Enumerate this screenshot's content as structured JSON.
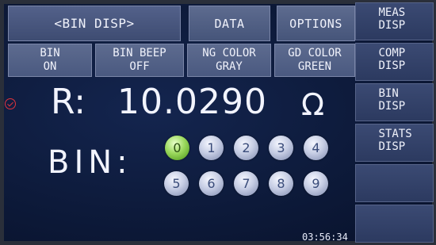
{
  "header": {
    "title": "<BIN DISP>",
    "data_label": "DATA",
    "options_label": "OPTIONS"
  },
  "settings": {
    "bin": {
      "label": "BIN",
      "value": "ON"
    },
    "bin_beep": {
      "label": "BIN BEEP",
      "value": "OFF"
    },
    "ng_color": {
      "label": "NG COLOR",
      "value": "GRAY"
    },
    "gd_color": {
      "label": "GD COLOR",
      "value": "GREEN"
    }
  },
  "side_menu": {
    "items": [
      {
        "line1": "MEAS",
        "line2": "DISP"
      },
      {
        "line1": "COMP",
        "line2": "DISP"
      },
      {
        "line1": "BIN",
        "line2": "DISP"
      },
      {
        "line1": "STATS",
        "line2": "DISP"
      },
      {
        "line1": "",
        "line2": ""
      },
      {
        "line1": "",
        "line2": ""
      }
    ]
  },
  "measurement": {
    "param_label": "R:",
    "value": "10.0290",
    "unit": "Ω"
  },
  "bin_display": {
    "label": "BIN:",
    "active_bin": "0",
    "lamps": [
      "0",
      "1",
      "2",
      "3",
      "4",
      "5",
      "6",
      "7",
      "8",
      "9"
    ]
  },
  "status": {
    "time": "03:56:34"
  },
  "colors": {
    "active_lamp": "#8fd14f",
    "inactive_lamp": "#b9c2dd",
    "indicator": "#e0343c"
  },
  "icons": {
    "trigger_indicator": "down-arrow-circle-icon"
  }
}
